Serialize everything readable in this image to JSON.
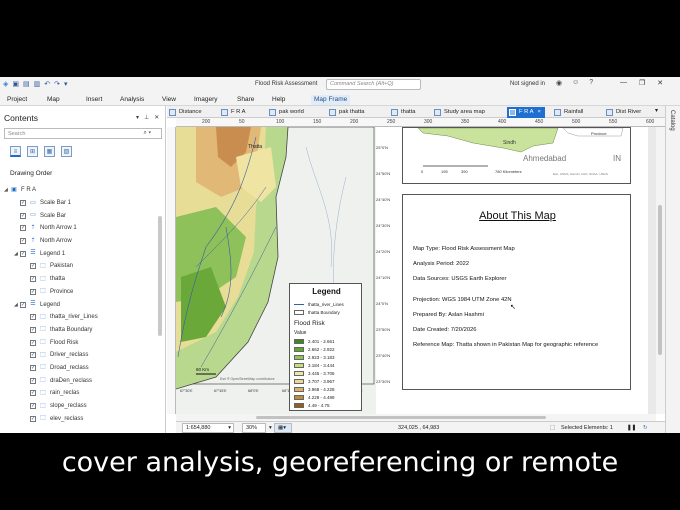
{
  "window": {
    "title": "Flood Risk Assessment",
    "command_search_placeholder": "Command Search (Alt+Q)",
    "signed_in": "Not signed in"
  },
  "ribbon": {
    "tabs": [
      "Project",
      "Map",
      "Insert",
      "Analysis",
      "View",
      "Imagery",
      "Share",
      "Help"
    ],
    "contextual_tab": "Map Frame"
  },
  "contents": {
    "title": "Contents",
    "search_placeholder": "Search",
    "drawing_order": "Drawing Order",
    "layers": [
      {
        "name": "F R A",
        "level": 0,
        "expanded": true,
        "checkbox": false,
        "icon": "layout-icon"
      },
      {
        "name": "Scale Bar 1",
        "level": 1,
        "checkbox": true,
        "icon": "scale-bar-icon"
      },
      {
        "name": "Scale Bar",
        "level": 1,
        "checkbox": true,
        "icon": "scale-bar-icon"
      },
      {
        "name": "North Arrow 1",
        "level": 1,
        "checkbox": true,
        "icon": "north-arrow-icon"
      },
      {
        "name": "North Arrow",
        "level": 1,
        "checkbox": true,
        "icon": "north-arrow-icon"
      },
      {
        "name": "Legend 1",
        "level": 1,
        "expanded": true,
        "checkbox": true,
        "icon": "legend-icon"
      },
      {
        "name": "Pakistan",
        "level": 2,
        "checkbox": true,
        "icon": "legend-item-icon"
      },
      {
        "name": "thatta",
        "level": 2,
        "checkbox": true,
        "icon": "legend-item-icon"
      },
      {
        "name": "Province",
        "level": 2,
        "checkbox": true,
        "icon": "legend-item-icon"
      },
      {
        "name": "Legend",
        "level": 1,
        "expanded": true,
        "checkbox": true,
        "icon": "legend-icon"
      },
      {
        "name": "thatta_river_Lines",
        "level": 2,
        "checkbox": true,
        "icon": "legend-item-icon"
      },
      {
        "name": "thatta Boundary",
        "level": 2,
        "checkbox": true,
        "icon": "legend-item-icon"
      },
      {
        "name": "Flood Risk",
        "level": 2,
        "checkbox": true,
        "icon": "legend-item-icon"
      },
      {
        "name": "Driver_reclass",
        "level": 2,
        "checkbox": true,
        "icon": "legend-item-icon"
      },
      {
        "name": "Droad_reclass",
        "level": 2,
        "checkbox": true,
        "icon": "legend-item-icon"
      },
      {
        "name": "draDen_reclass",
        "level": 2,
        "checkbox": true,
        "icon": "legend-item-icon"
      },
      {
        "name": "rain_reclas",
        "level": 2,
        "checkbox": true,
        "icon": "legend-item-icon"
      },
      {
        "name": "slope_reclass",
        "level": 2,
        "checkbox": true,
        "icon": "legend-item-icon"
      },
      {
        "name": "elev_reclass",
        "level": 2,
        "checkbox": true,
        "icon": "legend-item-icon"
      }
    ]
  },
  "view_tabs": [
    {
      "label": "Distance",
      "active": false
    },
    {
      "label": "F R A",
      "active": false
    },
    {
      "label": "pak world",
      "active": false
    },
    {
      "label": "pak thatta",
      "active": false
    },
    {
      "label": "thatta",
      "active": false
    },
    {
      "label": "Study area map",
      "active": false
    },
    {
      "label": "F R A",
      "active": true,
      "close": "×"
    },
    {
      "label": "Rainfall",
      "active": false
    },
    {
      "label": "Dist River",
      "active": false
    }
  ],
  "catalog_label": "Catalog",
  "ruler_ticks": [
    "200",
    "50",
    "100",
    "150",
    "200",
    "250",
    "300",
    "350",
    "400",
    "450",
    "500",
    "550",
    "600"
  ],
  "map_frame": {
    "place_label": "Thatta",
    "scale_label": "60 Km",
    "credits": "Esri ® OpenStreetMap contributors",
    "lat_labels": [
      "25°0'N",
      "24°50'N",
      "24°40'N",
      "24°30'N",
      "24°20'N",
      "24°10'N",
      "24°0'N",
      "23°50'N",
      "23°40'N",
      "23°30'N"
    ],
    "lon_labels": [
      "67°30'E",
      "67°45'E",
      "68°0'E",
      "68°15'E",
      "68°30'E",
      "68°45'E"
    ]
  },
  "legend": {
    "title": "Legend",
    "items": [
      "thatta_river_Lines",
      "thatta Boundary"
    ],
    "section": "Flood Risk",
    "value_label": "Value",
    "classes": [
      {
        "label": "2.401 - 2.661",
        "color": "#3a8a1e"
      },
      {
        "label": "2.662 - 2.922",
        "color": "#62a82d"
      },
      {
        "label": "2.923 - 3.183",
        "color": "#92c452"
      },
      {
        "label": "3.184 - 3.444",
        "color": "#c6dd7e"
      },
      {
        "label": "3.445 - 3.706",
        "color": "#ebe7a4"
      },
      {
        "label": "3.707 - 3.967",
        "color": "#f1d692"
      },
      {
        "label": "3.968 - 4.228",
        "color": "#dcb268"
      },
      {
        "label": "4.229 - 4.489",
        "color": "#bf8a3c"
      },
      {
        "label": "4.49 - 4.75",
        "color": "#9a5c1c"
      }
    ]
  },
  "inset_map": {
    "labels": [
      "Sindh",
      "Ahmedabad",
      "IN"
    ],
    "legend_item": "Province",
    "scale": [
      "0",
      "195",
      "390",
      "780 Kilometers"
    ],
    "credits": "Esri, USGS, Garmin, FAO, NOAA, USGS"
  },
  "about": {
    "title": "About This Map",
    "lines": [
      "Map Type: Flood Risk Assessment Map",
      "Analysis Period: 2022",
      "Data Sources: USGS Earth Explorer",
      "Projection: WGS 1984 UTM Zone 42N",
      "Prepared By: Aslan Hashmi",
      "Date Created: 7/20/2026",
      "Reference Map: Thatta shown in Pakistan Map for geographic reference"
    ]
  },
  "status": {
    "scale": "1:654,880",
    "zoom": "30%",
    "coordinates": "324,025 , 64,983",
    "selected": "Selected Elements: 1"
  },
  "caption": "cover analysis, georeferencing or remote"
}
